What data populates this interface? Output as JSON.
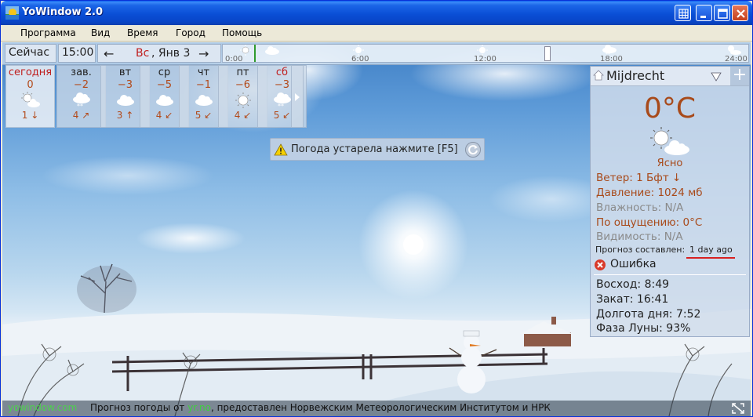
{
  "window": {
    "title": "YoWindow 2.0",
    "colors": {
      "titlebar": "#0A4FD6",
      "close": "#D2512B"
    }
  },
  "menu": {
    "items": [
      "Программа",
      "Вид",
      "Время",
      "Город",
      "Помощь"
    ]
  },
  "timebar": {
    "now_label": "Сейчас",
    "now_time": "15:00",
    "date_day": "Вс",
    "date_rest": ", Янв 3",
    "prev_arrow": "←",
    "next_arrow": "→",
    "ticks": [
      "0:00",
      "6:00",
      "12:00",
      "18:00",
      "24:00"
    ]
  },
  "forecast": {
    "days": [
      {
        "name": "сегодня",
        "temp": "0",
        "wind": "1",
        "wind_arrow": "↓",
        "icon": "sun-cloud-icon",
        "red": true
      },
      {
        "name": "зав.",
        "temp": "−2",
        "wind": "4",
        "wind_arrow": "↗",
        "icon": "snow-cloud-icon",
        "red": false
      },
      {
        "name": "вт",
        "temp": "−3",
        "wind": "3",
        "wind_arrow": "↑",
        "icon": "cloud-icon",
        "red": false
      },
      {
        "name": "ср",
        "temp": "−5",
        "wind": "4",
        "wind_arrow": "↙",
        "icon": "cloud-icon",
        "red": false
      },
      {
        "name": "чт",
        "temp": "−1",
        "wind": "5",
        "wind_arrow": "↙",
        "icon": "cloud-icon",
        "red": false
      },
      {
        "name": "пт",
        "temp": "−6",
        "wind": "4",
        "wind_arrow": "↙",
        "icon": "sun-icon",
        "red": false
      },
      {
        "name": "сб",
        "temp": "−3",
        "wind": "5",
        "wind_arrow": "↙",
        "icon": "snow-cloud-icon",
        "red": true
      }
    ]
  },
  "warning": {
    "text": "Погода устарела нажмите [F5]"
  },
  "panel": {
    "city": "Mijdrecht",
    "add": "+",
    "temp": "0°C",
    "condition": "Ясно",
    "rows": [
      {
        "label": "Ветер:",
        "value": "1 Бфт ↓",
        "grey": false
      },
      {
        "label": "Давление:",
        "value": "1024 мб",
        "grey": false
      },
      {
        "label": "Влажность:",
        "value": "N/A",
        "grey": true
      },
      {
        "label": "По ощущению:",
        "value": "0°C",
        "grey": false
      },
      {
        "label": "Видимость:",
        "value": "N/A",
        "grey": true
      }
    ],
    "forecast_made_label": "Прогноз составлен:",
    "forecast_made_value": "1 day ago",
    "error": "Ошибка",
    "sun": [
      {
        "label": "Восход:",
        "value": "8:49"
      },
      {
        "label": "Закат:",
        "value": "16:41"
      },
      {
        "label": "Долгота дня:",
        "value": "7:52"
      },
      {
        "label": "Фаза Луны:",
        "value": "93%"
      }
    ]
  },
  "status": {
    "site": "yowindow.com",
    "text_before": "Прогноз погоды от ",
    "link": "yr.no",
    "text_after": ", предоставлен Норвежским Метеорологическим Институтом и НРК"
  }
}
